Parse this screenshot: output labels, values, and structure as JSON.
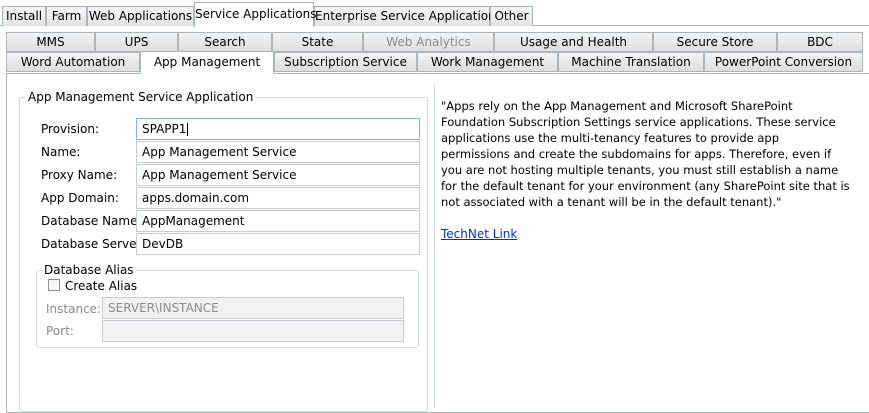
{
  "top_tabs": [
    "Install",
    "Farm",
    "Web Applications",
    "Service Applications",
    "Enterprise Service Applications",
    "Other"
  ],
  "active_top_tab": "Service Applications",
  "sub_tabs_row1": [
    "MMS",
    "UPS",
    "Search",
    "State",
    "Web Analytics",
    "Usage and Health",
    "Secure Store",
    "BDC"
  ],
  "sub_tabs_row2": [
    "Word Automation",
    "App Management",
    "Subscription Service",
    "Work Management",
    "Machine Translation",
    "PowerPoint Conversion"
  ],
  "active_sub_tab": "App Management",
  "disabled_sub_tab": "Web Analytics",
  "form": {
    "group_title": "App Management Service Application",
    "provision_label": "Provision:",
    "provision_value": "SPAPP1",
    "name_label": "Name:",
    "name_value": "App Management Service",
    "proxy_label": "Proxy Name:",
    "proxy_value": "App Management Service",
    "domain_label": "App Domain:",
    "domain_value": "apps.domain.com",
    "db_name_label": "Database Name:",
    "db_name_value": "AppManagement",
    "db_server_label": "Database Server:",
    "db_server_value": "DevDB",
    "alias": {
      "group_title": "Database Alias",
      "create_label": "Create Alias",
      "create_checked": false,
      "instance_label": "Instance:",
      "instance_value": "SERVER\\INSTANCE",
      "port_label": "Port:",
      "port_value": ""
    }
  },
  "description": "\"Apps rely on the App Management and Microsoft SharePoint Foundation Subscription Settings service applications. These service applications use the multi-tenancy features to provide app permissions and create the subdomains for apps. Therefore, even if you are not hosting multiple tenants, you must still establish a name for the default tenant for your environment (any SharePoint site that is not associated with a tenant will be in the default tenant).\"",
  "link_text": "TechNet Link"
}
